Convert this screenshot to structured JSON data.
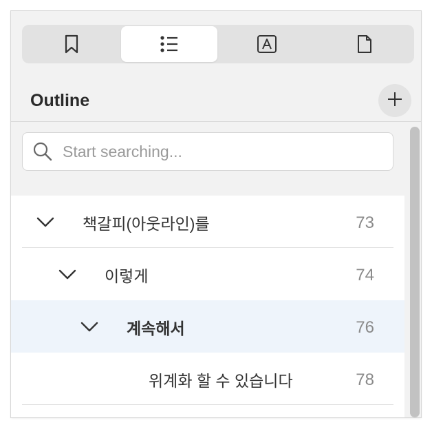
{
  "tabs": [
    {
      "icon": "bookmark-icon",
      "active": false
    },
    {
      "icon": "outline-list-icon",
      "active": true
    },
    {
      "icon": "annotation-icon",
      "active": false
    },
    {
      "icon": "page-icon",
      "active": false
    }
  ],
  "header": {
    "title": "Outline",
    "add_icon": "plus-icon"
  },
  "search": {
    "placeholder": "Start searching...",
    "value": ""
  },
  "outline": {
    "items": [
      {
        "label": "책갈피(아웃라인)를",
        "page": "73",
        "level": 0,
        "expanded": true
      },
      {
        "label": "이렇게",
        "page": "74",
        "level": 1,
        "expanded": true
      },
      {
        "label": "계속해서",
        "page": "76",
        "level": 2,
        "expanded": true,
        "selected": true
      },
      {
        "label": "위계화 할 수 있습니다",
        "page": "78",
        "level": 3
      }
    ]
  },
  "colors": {
    "panel_bg": "#f2f2f2",
    "selected_row_bg": "#eef4fb",
    "text": "#333333",
    "page_number": "#8a8a8a"
  }
}
